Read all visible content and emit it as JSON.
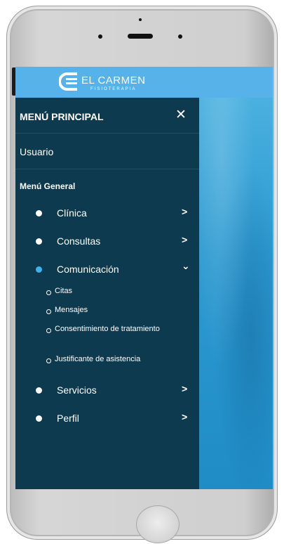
{
  "brand": {
    "name": "EL CARMEN",
    "subtitle": "FISIOTERAPIA",
    "color": "#56b2e8"
  },
  "menu": {
    "title": "MENÚ PRINCIPAL",
    "close_icon": "close-icon",
    "user_label": "Usuario",
    "section_title": "Menú General",
    "background": "#0e3a50",
    "items": [
      {
        "label": "Clínica",
        "chevron": ">"
      },
      {
        "label": "Consultas",
        "chevron": ">"
      },
      {
        "label": "Comunicación",
        "chevron": "⌄",
        "active": true
      },
      {
        "label": "Servicios",
        "chevron": ">"
      },
      {
        "label": "Perfil",
        "chevron": ">"
      }
    ],
    "subitems": [
      {
        "label": "Citas"
      },
      {
        "label": "Mensajes"
      },
      {
        "label": "Consentimiento de tratamiento"
      },
      {
        "label": "Justificante de asistencia"
      }
    ]
  }
}
